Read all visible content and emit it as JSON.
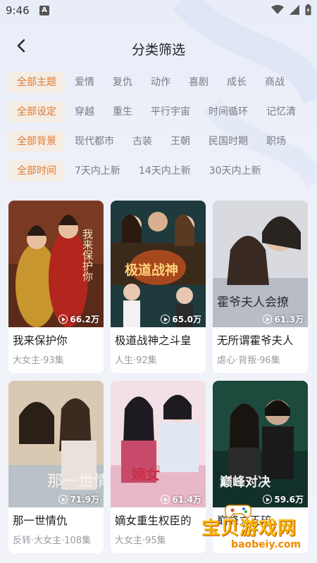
{
  "status": {
    "time": "9:46",
    "notif": "A"
  },
  "header": {
    "title": "分类筛选"
  },
  "filters": [
    {
      "items": [
        "全部主题",
        "爱情",
        "复仇",
        "动作",
        "喜剧",
        "成长",
        "商战"
      ]
    },
    {
      "items": [
        "全部设定",
        "穿越",
        "重生",
        "平行宇宙",
        "时间循环",
        "记忆清"
      ]
    },
    {
      "items": [
        "全部背景",
        "现代都市",
        "古装",
        "王朝",
        "民国时期",
        "职场"
      ]
    },
    {
      "items": [
        "全部时间",
        "7天内上新",
        "14天内上新",
        "30天内上新"
      ]
    }
  ],
  "cards": [
    {
      "title": "我来保护你",
      "meta": "大女主·93集",
      "views": "66.2万",
      "poster_text": "我来保护你"
    },
    {
      "title": "极道战神之斗皇",
      "meta": "人生·92集",
      "views": "65.0万",
      "poster_text": "极道战神"
    },
    {
      "title": "无所谓霍爷夫人",
      "meta": "虐心·背叛·96集",
      "views": "61.3万",
      "poster_text": "霍爷夫人会撩"
    },
    {
      "title": "那一世情仇",
      "meta": "反转·大女主·108集",
      "views": "71.9万",
      "poster_text": "那一世情"
    },
    {
      "title": "嫡女重生权臣的",
      "meta": "大女主·95集",
      "views": "61.4万",
      "poster_text": "嫡女"
    },
    {
      "title": "巅峰之王碎",
      "meta": "",
      "views": "59.6万",
      "poster_text": "巅峰对决"
    }
  ],
  "watermark": {
    "text": "宝贝游戏网",
    "url": "baobeiy.com"
  }
}
